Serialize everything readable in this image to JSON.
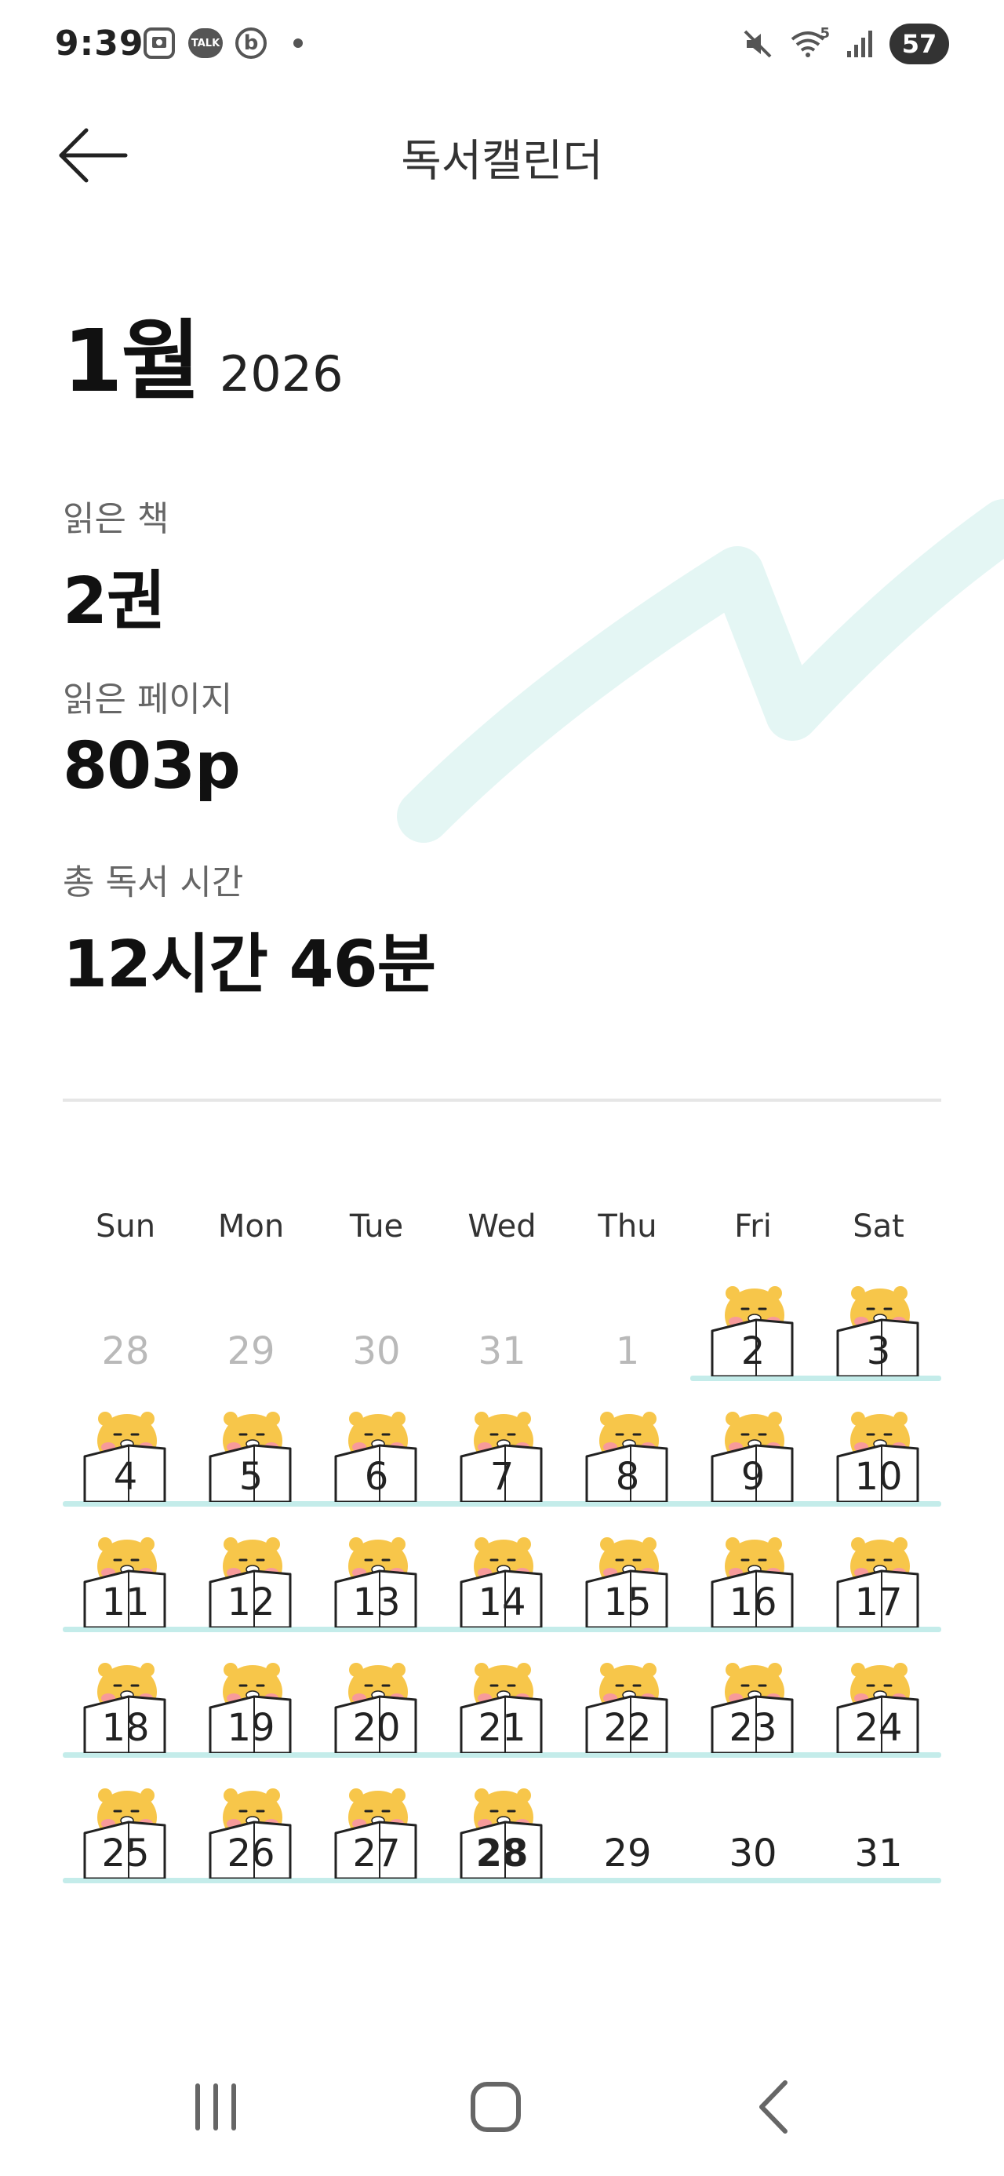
{
  "status_bar": {
    "time": "9:39",
    "talk_label": "TALK",
    "b_label": "b",
    "wifi_label": "5",
    "battery": "57"
  },
  "header": {
    "title": "독서캘린더",
    "back_icon": "arrow-left-icon"
  },
  "month": {
    "label": "1월",
    "year": "2026"
  },
  "stats": {
    "books_label": "읽은 책",
    "books_value": "2권",
    "pages_label": "읽은 페이지",
    "pages_value": "803p",
    "time_label": "총 독서 시간",
    "time_value": "12시간 46분"
  },
  "calendar": {
    "weekdays": [
      "Sun",
      "Mon",
      "Tue",
      "Wed",
      "Thu",
      "Fri",
      "Sat"
    ],
    "weeks": [
      [
        {
          "day": "28",
          "other": true,
          "sticker": false
        },
        {
          "day": "29",
          "other": true,
          "sticker": false
        },
        {
          "day": "30",
          "other": true,
          "sticker": false
        },
        {
          "day": "31",
          "other": true,
          "sticker": false
        },
        {
          "day": "1",
          "other": true,
          "sticker": false
        },
        {
          "day": "2",
          "other": false,
          "sticker": true
        },
        {
          "day": "3",
          "other": false,
          "sticker": true
        }
      ],
      [
        {
          "day": "4",
          "other": false,
          "sticker": true
        },
        {
          "day": "5",
          "other": false,
          "sticker": true
        },
        {
          "day": "6",
          "other": false,
          "sticker": true
        },
        {
          "day": "7",
          "other": false,
          "sticker": true
        },
        {
          "day": "8",
          "other": false,
          "sticker": true
        },
        {
          "day": "9",
          "other": false,
          "sticker": true
        },
        {
          "day": "10",
          "other": false,
          "sticker": true
        }
      ],
      [
        {
          "day": "11",
          "other": false,
          "sticker": true
        },
        {
          "day": "12",
          "other": false,
          "sticker": true
        },
        {
          "day": "13",
          "other": false,
          "sticker": true
        },
        {
          "day": "14",
          "other": false,
          "sticker": true
        },
        {
          "day": "15",
          "other": false,
          "sticker": true
        },
        {
          "day": "16",
          "other": false,
          "sticker": true
        },
        {
          "day": "17",
          "other": false,
          "sticker": true
        }
      ],
      [
        {
          "day": "18",
          "other": false,
          "sticker": true
        },
        {
          "day": "19",
          "other": false,
          "sticker": true
        },
        {
          "day": "20",
          "other": false,
          "sticker": true
        },
        {
          "day": "21",
          "other": false,
          "sticker": true
        },
        {
          "day": "22",
          "other": false,
          "sticker": true
        },
        {
          "day": "23",
          "other": false,
          "sticker": true
        },
        {
          "day": "24",
          "other": false,
          "sticker": true
        }
      ],
      [
        {
          "day": "25",
          "other": false,
          "sticker": true
        },
        {
          "day": "26",
          "other": false,
          "sticker": true
        },
        {
          "day": "27",
          "other": false,
          "sticker": true
        },
        {
          "day": "28",
          "other": false,
          "sticker": true,
          "today": true
        },
        {
          "day": "29",
          "other": false,
          "sticker": false
        },
        {
          "day": "30",
          "other": false,
          "sticker": false
        },
        {
          "day": "31",
          "other": false,
          "sticker": false
        }
      ]
    ]
  },
  "nav_bar": {
    "recents_icon": "recents-icon",
    "home_icon": "home-icon",
    "back_icon": "back-chevron-icon"
  },
  "colors": {
    "accent_mint": "#c4ecea",
    "deco_mint": "#e4f6f4",
    "sticker_face": "#f7c64a",
    "cheek": "#f79a9a"
  }
}
